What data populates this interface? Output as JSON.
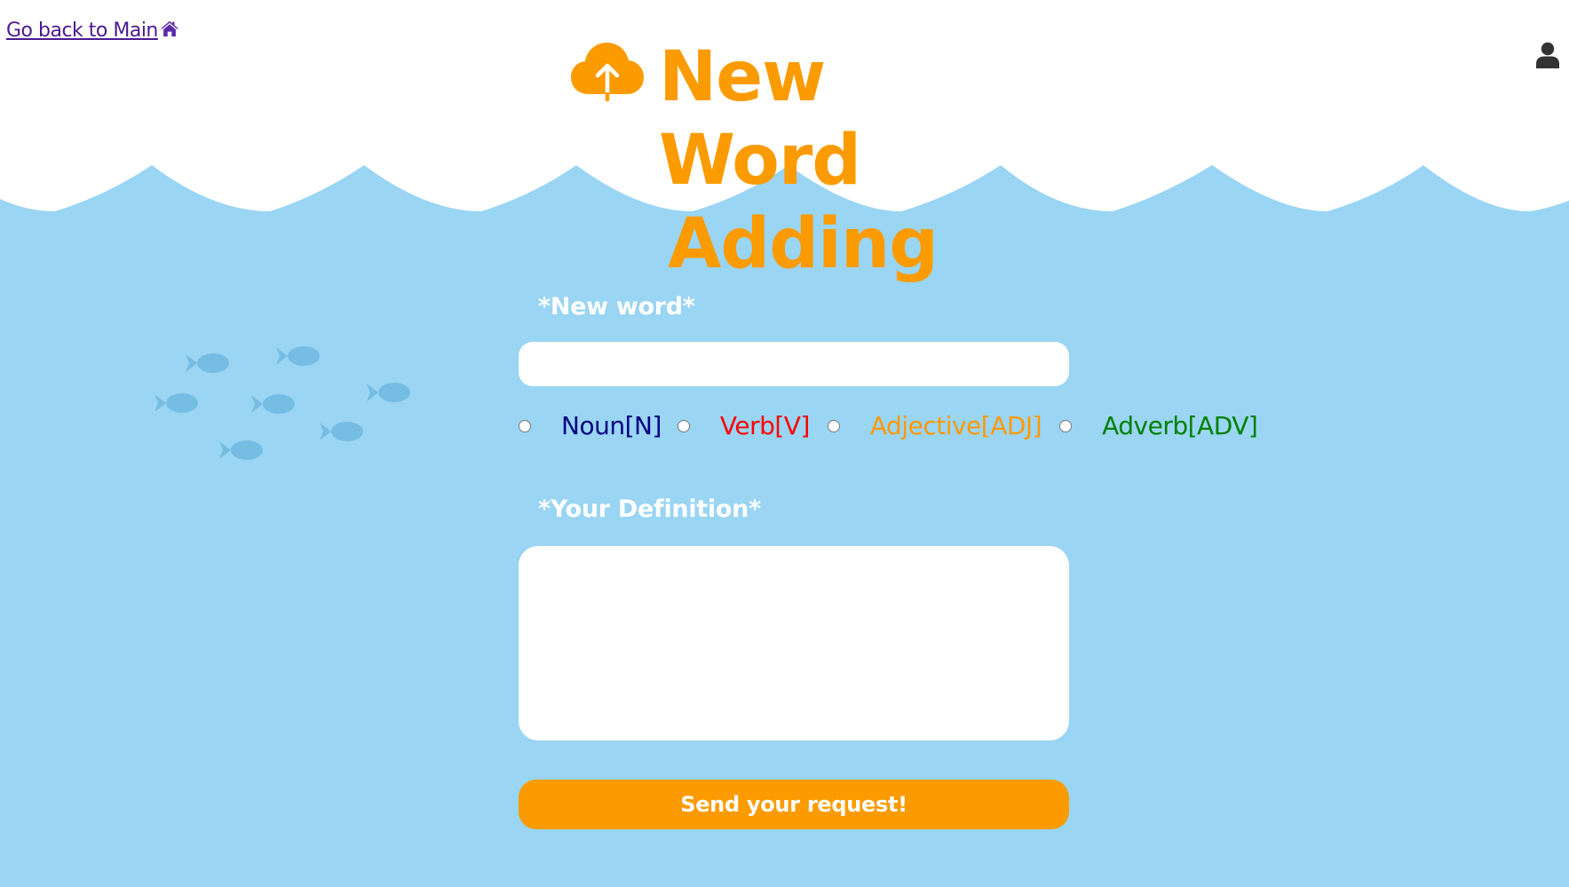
{
  "nav": {
    "back_label": "Go back to Main",
    "home_icon": "home-icon",
    "user_icon": "user-icon"
  },
  "header": {
    "title_line1": "New Word",
    "title_line2": "Adding",
    "title_icon": "cloud-upload-icon"
  },
  "form": {
    "word_label": "*New word*",
    "word_value": "",
    "parts_of_speech": [
      {
        "label": "Noun[N]",
        "color": "#000080",
        "selected": false
      },
      {
        "label": "Verb[V]",
        "color": "#ff0000",
        "selected": false
      },
      {
        "label": "Adjective[ADJ]",
        "color": "#ff9900",
        "selected": false
      },
      {
        "label": "Adverb[ADV]",
        "color": "#008000",
        "selected": false
      }
    ],
    "definition_label": "*Your Definition*",
    "definition_value": "",
    "submit_label": "Send your request!"
  },
  "colors": {
    "background": "#9ad5f3",
    "accent": "#fb9b00",
    "link": "#4b1a8f",
    "fish": "#75bde2"
  }
}
